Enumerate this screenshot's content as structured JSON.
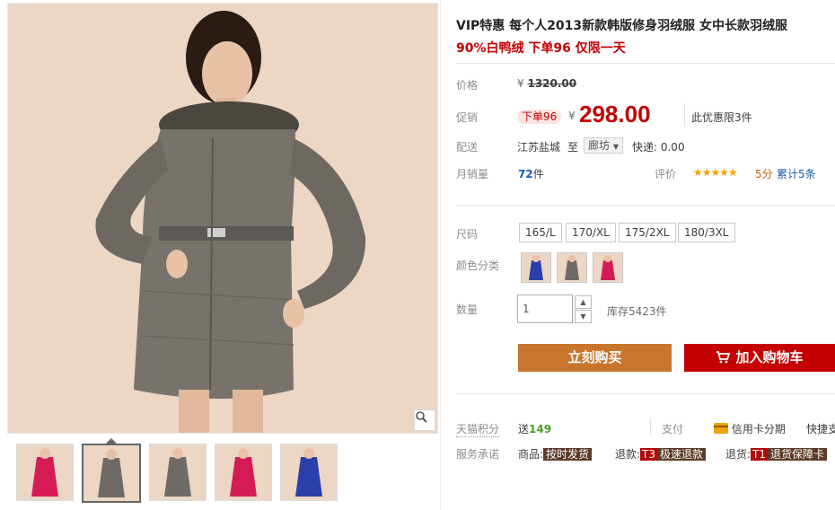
{
  "product": {
    "title": "VIP特惠 每个人2013新款韩版修身羽绒服 女中长款羽绒服",
    "subtitle": "90%白鸭绒 下单96 仅限一天"
  },
  "price": {
    "label": "价格",
    "currency": "¥",
    "original": "1320.00"
  },
  "promo": {
    "label": "促销",
    "badge": "下单96",
    "currency": "¥",
    "price": "298.00",
    "limit": "此优惠限3件"
  },
  "shipping": {
    "label": "配送",
    "from": "江苏盐城",
    "to_word": "至",
    "destination": "廊坊",
    "fee": "快递: 0.00"
  },
  "sales": {
    "label": "月销量",
    "count": "72",
    "unit": "件",
    "rating_label": "评价",
    "stars": "★★★★★",
    "score": "5分",
    "review_count": "累计5条"
  },
  "options": {
    "size_label": "尺码",
    "sizes": [
      "165/L",
      "170/XL",
      "175/2XL",
      "180/3XL"
    ],
    "color_label": "颜色分类",
    "colors": [
      "#2b3fa8",
      "#6e6a66",
      "#d41b55"
    ]
  },
  "quantity": {
    "label": "数量",
    "value": "1",
    "stock": "库存5423件"
  },
  "actions": {
    "buy": "立刻购买",
    "cart": "加入购物车"
  },
  "points": {
    "label": "天猫积分",
    "send": "送",
    "amount": "149",
    "pay_label": "支付",
    "credit": "信用卡分期",
    "express": "快捷支"
  },
  "service": {
    "label": "服务承诺",
    "goods": "商品:",
    "goods_tag": "按时发货",
    "refund": "退款:",
    "refund_code": "T3",
    "refund_tag": "极速退款",
    "return": "退货:",
    "return_code": "T1",
    "return_tag": "退货保障卡"
  },
  "thumbnails": [
    "#d41b55",
    "#6e6a66",
    "#6e6a66",
    "#d41b55",
    "#2b3fa8"
  ],
  "colors": {
    "accent_red": "#c40000",
    "buy_orange": "#c8762e",
    "background_skin": "#ecd6c4"
  }
}
